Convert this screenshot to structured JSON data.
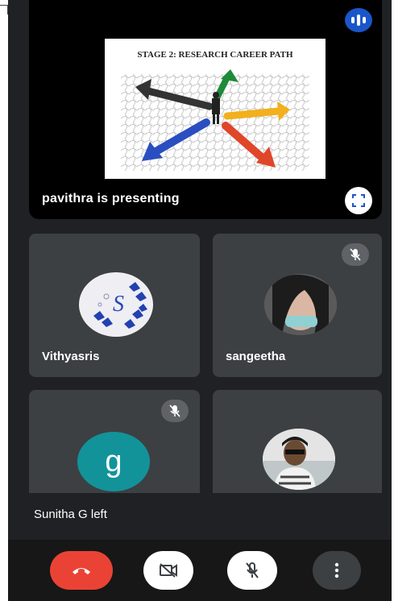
{
  "presentation": {
    "slide_title": "STAGE 2: RESEARCH CAREER PATH",
    "presenting_label": "pavithra is presenting",
    "audio_icon": "audio-level-icon",
    "fullscreen_icon": "fullscreen-icon"
  },
  "participants": [
    {
      "name": "Vithyasris",
      "muted": false,
      "avatar": "butterfly-s-photo"
    },
    {
      "name": "sangeetha",
      "muted": true,
      "avatar": "profile-photo"
    },
    {
      "name": "",
      "muted": true,
      "avatar_letter": "g"
    },
    {
      "name": "",
      "muted": false,
      "avatar": "profile-photo"
    }
  ],
  "status": {
    "message": "Sunitha G left"
  },
  "controls": {
    "end_call_icon": "phone-hangup-icon",
    "camera_icon": "camera-off-icon",
    "mic_icon": "mic-off-icon",
    "more_icon": "more-vertical-icon"
  },
  "colors": {
    "background": "#202124",
    "tile": "#3c4043",
    "end_call": "#ea4335",
    "audio_indicator": "#1a56c9",
    "letter_avatar": "#12939a"
  }
}
